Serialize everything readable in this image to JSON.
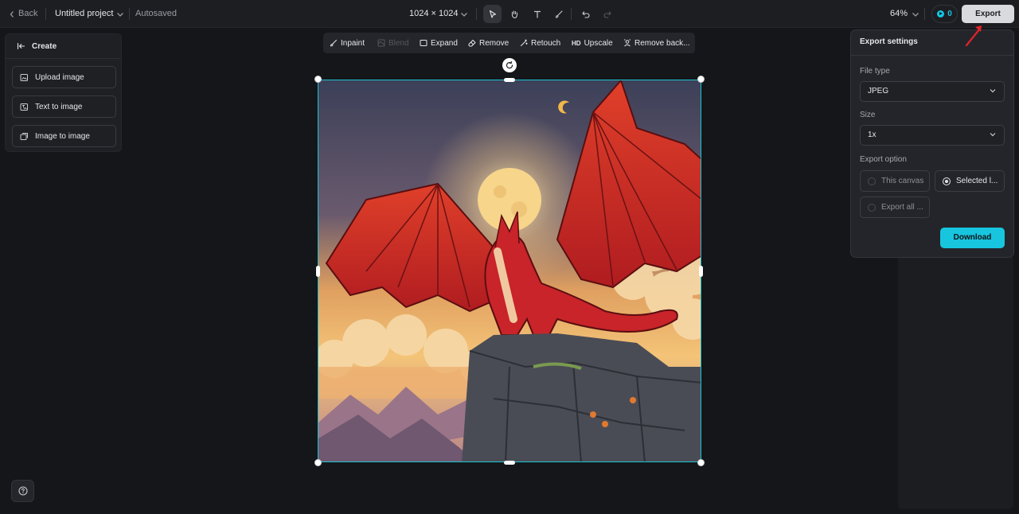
{
  "topbar": {
    "back_label": "Back",
    "project_name": "Untitled project",
    "save_status": "Autosaved",
    "canvas_size": "1024 × 1024",
    "zoom": "64%",
    "credits": "0",
    "export_label": "Export"
  },
  "create_panel": {
    "title": "Create",
    "items": [
      "Upload image",
      "Text to image",
      "Image to image"
    ]
  },
  "edit_toolbar": {
    "inpaint": "Inpaint",
    "blend": "Blend",
    "expand": "Expand",
    "remove": "Remove",
    "retouch": "Retouch",
    "upscale_badge": "HD",
    "upscale": "Upscale",
    "remove_bg": "Remove back..."
  },
  "export_settings": {
    "title": "Export settings",
    "file_type_label": "File type",
    "file_type_value": "JPEG",
    "size_label": "Size",
    "size_value": "1x",
    "export_option_label": "Export option",
    "options": [
      "This canvas",
      "Selected l...",
      "Export all ..."
    ],
    "selected_option": "Selected l...",
    "download_label": "Download"
  },
  "colors": {
    "accent": "#17c5df",
    "selection": "#1bc4d4",
    "annotation_arrow": "#e0242a"
  },
  "icons": [
    "chevron-left-icon",
    "chevron-down-icon",
    "cursor-icon",
    "hand-icon",
    "text-icon",
    "brush-icon",
    "undo-icon",
    "redo-icon",
    "credit-icon",
    "arrow-left-icon",
    "upload-image-icon",
    "text-image-icon",
    "image-image-icon",
    "inpaint-icon",
    "blend-icon",
    "expand-icon",
    "eraser-icon",
    "retouch-icon",
    "remove-bg-icon",
    "rotate-icon",
    "help-icon"
  ]
}
